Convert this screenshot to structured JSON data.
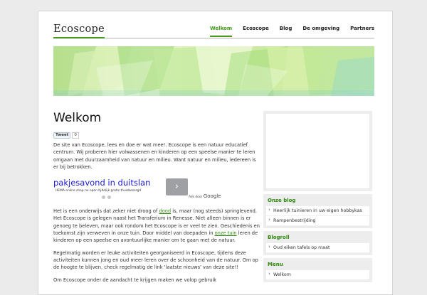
{
  "site": {
    "logo": "Ecoscope"
  },
  "nav": {
    "items": [
      {
        "label": "Welkom",
        "active": true
      },
      {
        "label": "Ecoscope",
        "active": false
      },
      {
        "label": "Blog",
        "active": false
      },
      {
        "label": "De omgeving",
        "active": false
      },
      {
        "label": "Partners",
        "active": false
      }
    ]
  },
  "main": {
    "title": "Welkom",
    "tweet": {
      "label": "Tweet",
      "count": "0"
    },
    "intro": "De site van Ecoscope, lees en doe er wat mee!. Ecoscope is een natuur educatief centrum. Wij proberen hier volwassenen en kinderen op een speelse manier te leren omgaan met duurzaamheid van natuur en milieu. Want natuur en milieu, iedereen is er bij betrokken.",
    "ad": {
      "title": "pakjesavond in duitslan",
      "subtitle": "HEMA online shop nu open tijdelijk gratis thuisbezorgd",
      "next": "›",
      "by": "Ads door",
      "google": "Google"
    },
    "para2": {
      "p1": "Het is een onderwijs dat zeker niet droog of ",
      "link1": "dood",
      "p2": " is, maar (nog steeds) springlevend. Het Ecoscope is gelegen naast het Transferium in Renesse. Niet alleen binnen is er genoeg te beleven, maar ook rondom het Ecoscope is er veel te zien. Geschiedenis en toekomst zijn verweven in onze tuin. Door middel van doepaden in ",
      "link2": "onze tuin",
      "p3": " leren de kinderen op een speelse en avontuurlijke manier om te gaan met de natuur."
    },
    "para3": "Regelmatig worden er leuke activiteiten georganiseerd in Ecoscope, tijdens deze activiteiten kunnen jong en oud meer leren over de schoonheid van de natuur. Om op de hoogte te blijven, check regelmatig de link 'laatste nieuws' van deze site!!",
    "para4": "Om Ecoscope onder de aandacht te krijgen maken we volop gebruik"
  },
  "sidebar": {
    "blog": {
      "title": "Onze blog",
      "items": [
        "Heerlijk tuinieren in uw eigen hobbykas",
        "Rampenbestrijding"
      ]
    },
    "blogroll": {
      "title": "Blogroll",
      "items": [
        "Oud eiken tafels op maat"
      ]
    },
    "menu": {
      "title": "Menu",
      "items": [
        "Welkom"
      ]
    }
  }
}
